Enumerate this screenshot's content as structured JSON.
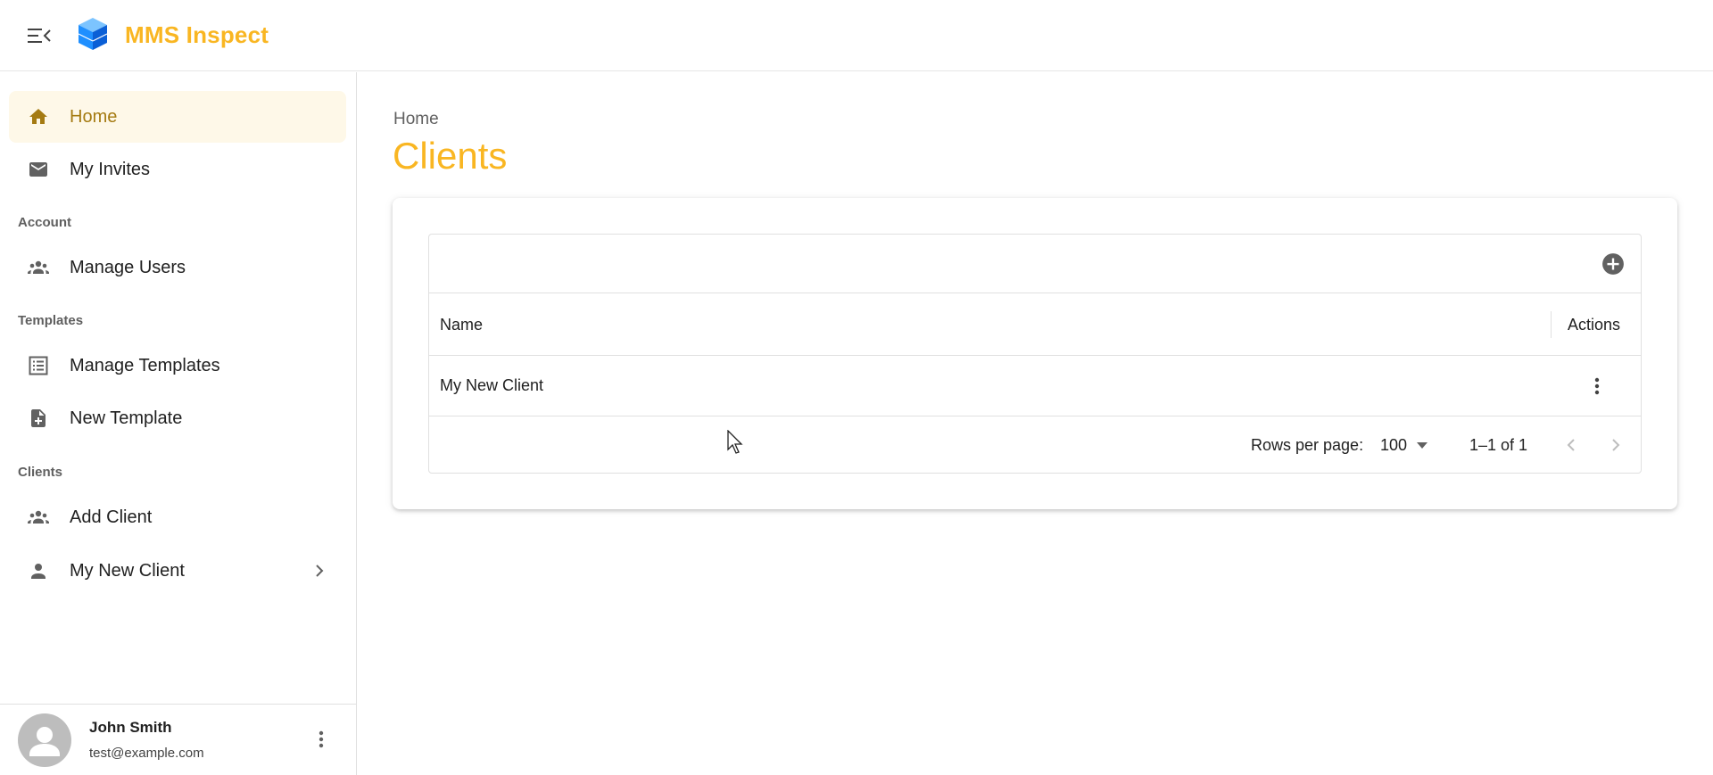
{
  "app": {
    "title": "MMS Inspect"
  },
  "colors": {
    "accent": "#f9b622",
    "active_bg": "#fef8e8",
    "active_text": "#a57b12",
    "logo_blue": "#1f8fff"
  },
  "sidebar": {
    "items": [
      {
        "label": "Home",
        "icon": "home-icon",
        "active": true
      },
      {
        "label": "My Invites",
        "icon": "mail-icon"
      }
    ],
    "sections": [
      {
        "label": "Account",
        "items": [
          {
            "label": "Manage Users",
            "icon": "group-icon"
          }
        ]
      },
      {
        "label": "Templates",
        "items": [
          {
            "label": "Manage Templates",
            "icon": "list-icon"
          },
          {
            "label": "New Template",
            "icon": "note-add-icon"
          }
        ]
      },
      {
        "label": "Clients",
        "items": [
          {
            "label": "Add Client",
            "icon": "group-icon"
          },
          {
            "label": "My New Client",
            "icon": "person-icon",
            "has_children": true
          }
        ]
      }
    ]
  },
  "user": {
    "name": "John Smith",
    "email": "test@example.com"
  },
  "main": {
    "breadcrumb": "Home",
    "title": "Clients",
    "grid": {
      "columns": [
        "Name",
        "Actions"
      ],
      "rows": [
        {
          "name": "My New Client"
        }
      ],
      "footer": {
        "rows_per_page_label": "Rows per page:",
        "rows_per_page": "100",
        "page_info": "1–1 of 1"
      }
    }
  }
}
